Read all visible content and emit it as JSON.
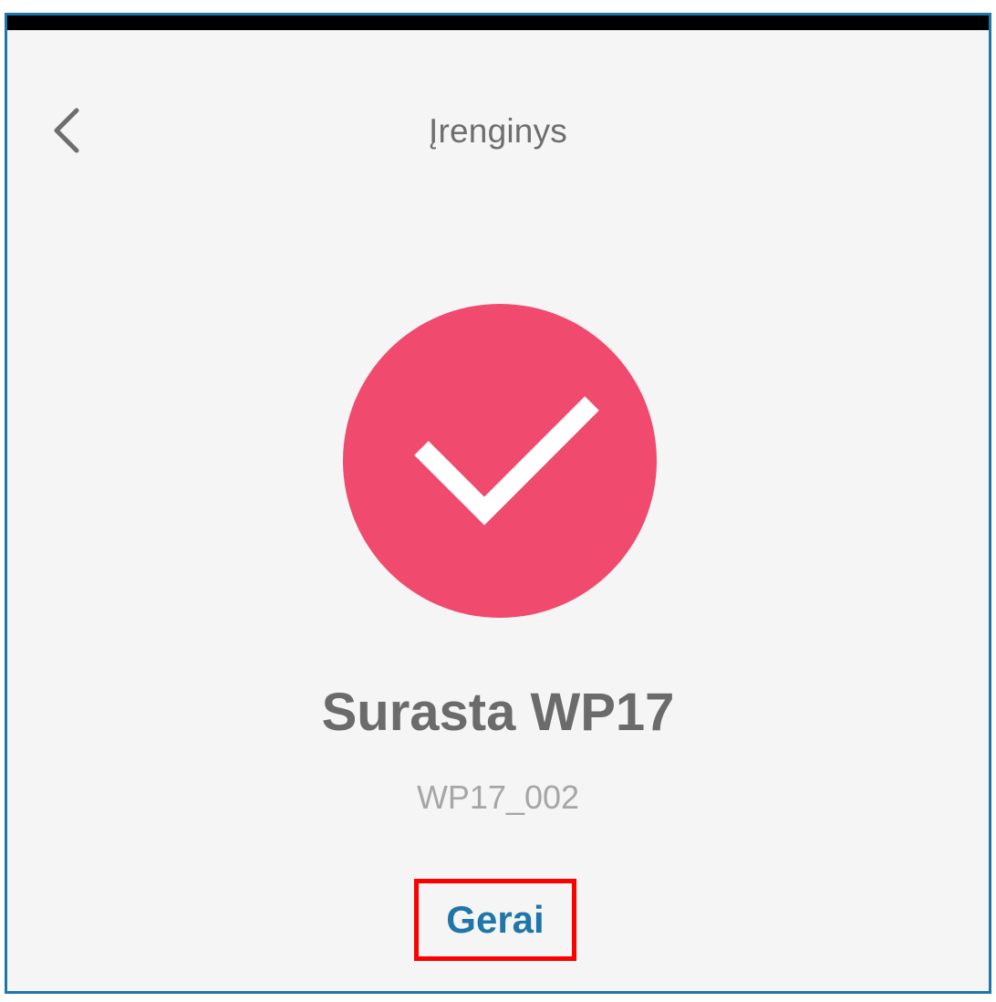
{
  "header": {
    "title": "Įrenginys",
    "back_icon": "chevron-left-icon"
  },
  "status": {
    "icon": "checkmark-circle-icon",
    "accent_color": "#f04a6e"
  },
  "device": {
    "name": "Surasta WP17",
    "id": "WP17_002"
  },
  "actions": {
    "ok_label": "Gerai",
    "ok_color": "#1f76a9"
  }
}
